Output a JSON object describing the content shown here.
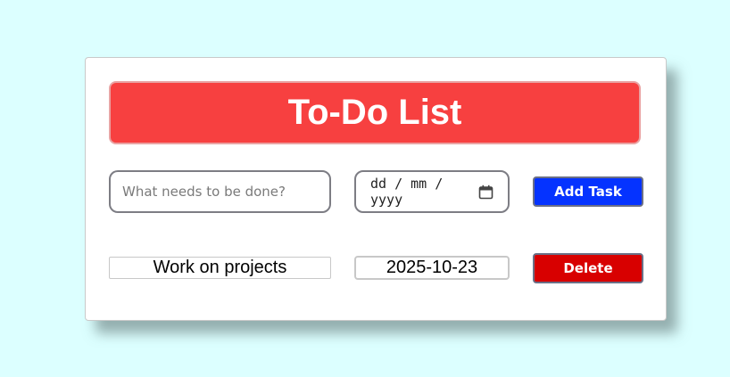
{
  "app": {
    "title": "To-Do List"
  },
  "form": {
    "task_placeholder": "What needs to be done?",
    "task_value": "",
    "date_placeholder": "dd / mm / yyyy",
    "calendar_icon": "calendar-icon",
    "add_label": "Add Task"
  },
  "tasks": [
    {
      "text": "Work on projects",
      "date": "2025-10-23",
      "delete_label": "Delete"
    }
  ],
  "colors": {
    "background": "#dcffff",
    "header": "#f74040",
    "add_button": "#0533ff",
    "delete_button": "#d80000"
  }
}
